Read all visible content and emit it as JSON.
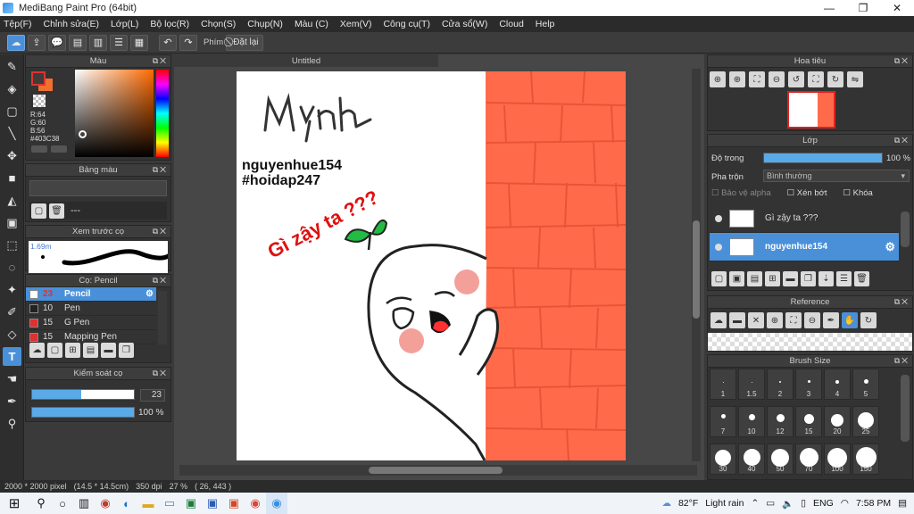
{
  "window": {
    "title": "MediBang Paint Pro (64bit)",
    "min": "—",
    "max": "❐",
    "close": "✕"
  },
  "menu": [
    "Tệp(F)",
    "Chỉnh sửa(E)",
    "Lớp(L)",
    "Bộ lọc(R)",
    "Chọn(S)",
    "Chụp(N)",
    "Màu (C)",
    "Xem(V)",
    "Công cụ(T)",
    "Cửa sổ(W)",
    "Cloud",
    "Help"
  ],
  "toolbar": {
    "undo_icon": "undo-icon",
    "redo_icon": "redo-icon",
    "keys_label": "Phím",
    "reset_label": "Đặt lại"
  },
  "tools": [
    "brush-tool-icon",
    "eraser-tool-icon",
    "shape-tool-icon",
    "line-tool-icon",
    "move-tool-icon",
    "fill-rect-tool-icon",
    "bucket-tool-icon",
    "gradient-tool-icon",
    "select-tool-icon",
    "lasso-tool-icon",
    "magic-wand-tool-icon",
    "select-pen-tool-icon",
    "select-eraser-tool-icon",
    "text-tool-icon",
    "hand-tool-icon",
    "eyedropper-tool-icon",
    "dropper2-tool-icon"
  ],
  "color_panel": {
    "title": "Màu",
    "r": "R:64",
    "g": "G:60",
    "b": "B:56",
    "hex": "#403C38",
    "fg_color": "#403C38",
    "bg_color": "#F07030"
  },
  "palette_panel": {
    "title": "Bảng màu",
    "value": "---"
  },
  "brush_preview": {
    "title": "Xem trước cọ",
    "size": "1.69m"
  },
  "brush_panel": {
    "title": "Cọ: Pencil",
    "items": [
      {
        "num": "23",
        "name": "Pencil",
        "color": "#ffffff",
        "selected": true
      },
      {
        "num": "10",
        "name": "Pen",
        "color": "#222222",
        "selected": false
      },
      {
        "num": "15",
        "name": "G Pen",
        "color": "#e03030",
        "selected": false
      },
      {
        "num": "15",
        "name": "Mapping Pen",
        "color": "#e03030",
        "selected": false
      }
    ]
  },
  "control_panel": {
    "title": "Kiểm soát cọ",
    "size_value": "23",
    "opacity_value": "100 %",
    "size_fraction": 0.48,
    "opacity_fraction": 1.0
  },
  "document": {
    "tab": "Untitled",
    "text_name": "Mynh",
    "text_user": "nguyenhue154",
    "text_tag": "#hoidap247",
    "text_red": "Gì zậy ta ???"
  },
  "navigator": {
    "title": "Hoa tiêu"
  },
  "layer_panel": {
    "title": "Lớp",
    "opacity_label": "Độ trong",
    "opacity_value": "100 %",
    "opacity_fraction": 1.0,
    "blend_label": "Pha trộn",
    "blend_value": "Bình thường",
    "protect_alpha": "Bảo vệ alpha",
    "clipping": "Xén bớt",
    "lock": "Khóa",
    "layers": [
      {
        "name": "Gì zậy ta ???",
        "selected": false
      },
      {
        "name": "nguyenhue154",
        "selected": true
      }
    ]
  },
  "reference_panel": {
    "title": "Reference"
  },
  "brush_size_panel": {
    "title": "Brush Size",
    "sizes": [
      "1",
      "1.5",
      "2",
      "3",
      "4",
      "5",
      "7",
      "10",
      "12",
      "15",
      "20",
      "25",
      "30",
      "40",
      "50",
      "70",
      "100",
      "150"
    ]
  },
  "status": {
    "size": "2000 * 2000 pixel",
    "cm": "(14.5 * 14.5cm)",
    "dpi": "350 dpi",
    "zoom": "27 %",
    "coords": "( 26, 443 )"
  },
  "taskbar": {
    "weather_temp": "82°F",
    "weather_text": "Light rain",
    "lang": "ENG",
    "time": "7:58 PM"
  }
}
